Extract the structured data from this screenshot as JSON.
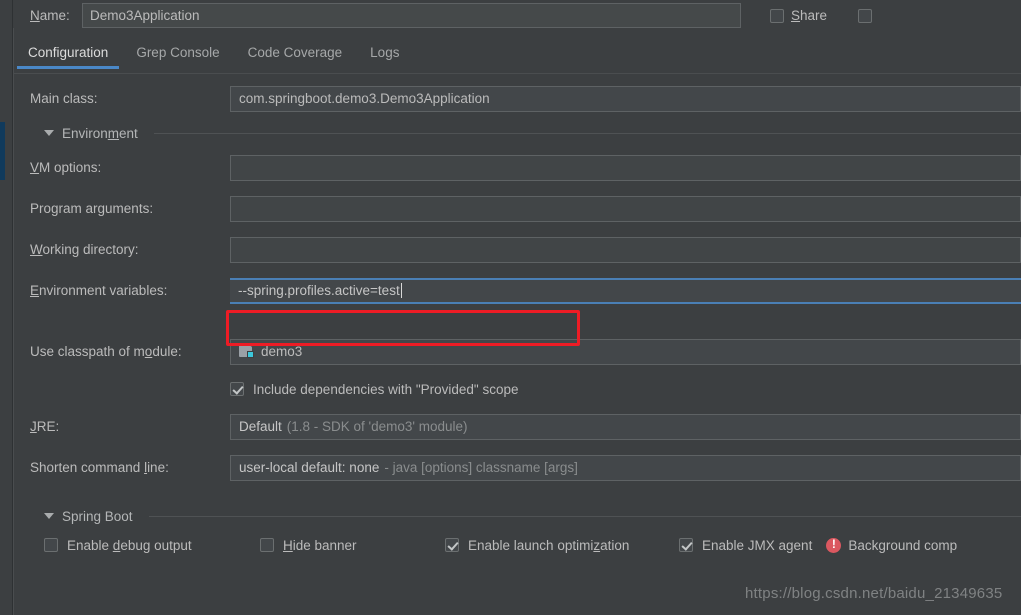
{
  "window": {
    "name_label": "Name:",
    "name_value": "Demo3Application",
    "share_label": "Share"
  },
  "tabs": [
    {
      "label": "Configuration",
      "active": true
    },
    {
      "label": "Grep Console",
      "active": false
    },
    {
      "label": "Code Coverage",
      "active": false
    },
    {
      "label": "Logs",
      "active": false
    }
  ],
  "configuration": {
    "main_class": {
      "label": "Main class:",
      "value": "com.springboot.demo3.Demo3Application"
    },
    "environment_section": {
      "label": "Environment",
      "expanded": true
    },
    "vm_options": {
      "label": "VM options:",
      "value": ""
    },
    "program_arguments": {
      "label": "Program arguments:",
      "value": ""
    },
    "working_directory": {
      "label": "Working directory:",
      "value": ""
    },
    "environment_variables": {
      "label": "Environment variables:",
      "value": "--spring.profiles.active=test",
      "focused": true,
      "highlight_color": "#ee1c25"
    },
    "classpath_module": {
      "label": "Use classpath of module:",
      "value": "demo3",
      "icon": "module-folder-icon"
    },
    "include_provided": {
      "label": "Include dependencies with \"Provided\" scope",
      "checked": true
    },
    "jre": {
      "label": "JRE:",
      "value_main": "Default",
      "value_detail": "(1.8 - SDK of 'demo3' module)"
    },
    "shorten_command_line": {
      "label": "Shorten command line:",
      "value_main": "user-local default: none",
      "value_detail": "- java [options] classname [args]"
    },
    "spring_boot_section": {
      "label": "Spring Boot",
      "expanded": true
    },
    "spring_boot_options": [
      {
        "label": "Enable debug output",
        "checked": false
      },
      {
        "label": "Hide banner",
        "checked": false
      },
      {
        "label": "Enable launch optimization",
        "checked": true
      },
      {
        "label": "Enable JMX agent",
        "checked": true
      },
      {
        "label": "Background comp",
        "checked": false
      }
    ]
  },
  "watermark": "https://blog.csdn.net/baidu_21349635",
  "colors": {
    "background": "#3c3f41",
    "text": "#bbbbbb",
    "accent": "#4a88c7",
    "focus_border": "#4a7fb5",
    "highlight": "#ee1c25",
    "error": "#db5860",
    "module_badge": "#3cc8dc"
  }
}
